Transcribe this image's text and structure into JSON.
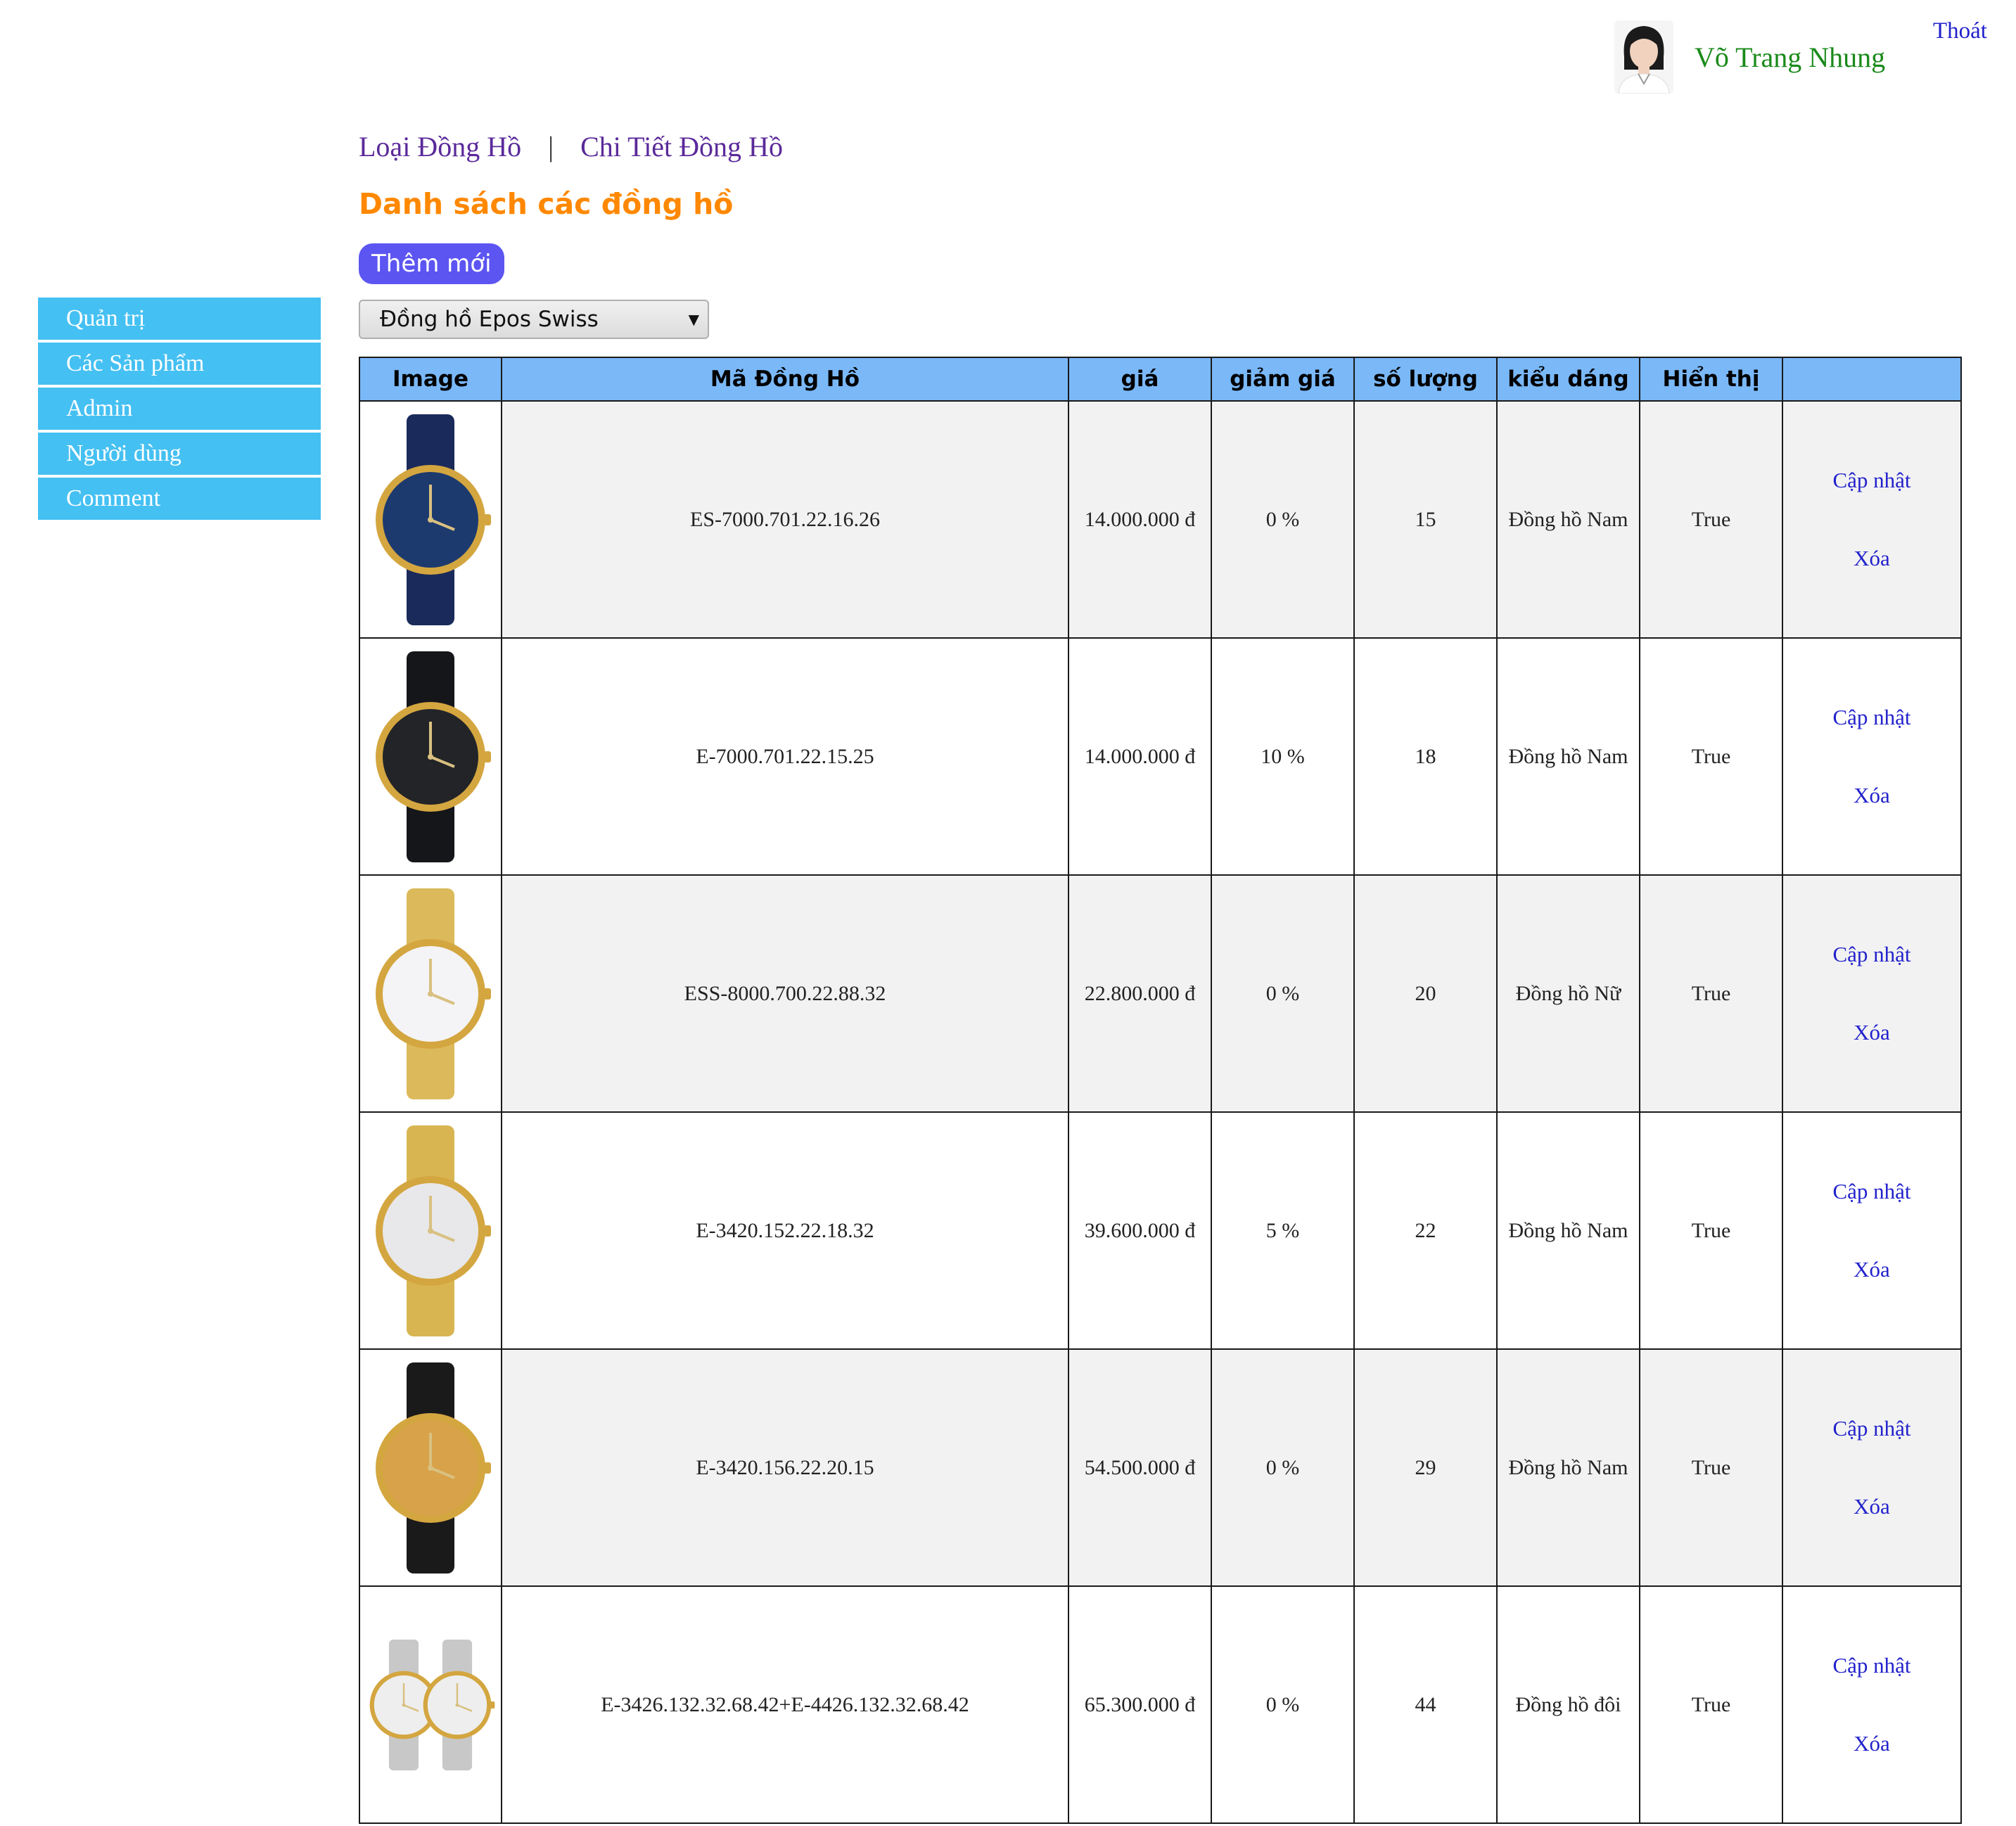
{
  "header": {
    "user_name": "Võ Trang Nhung",
    "logout_label": "Thoát"
  },
  "sidebar": {
    "items": [
      {
        "label": "Quản trị"
      },
      {
        "label": "Các Sản phẩm"
      },
      {
        "label": "Admin"
      },
      {
        "label": "Người dùng"
      },
      {
        "label": "Comment"
      }
    ]
  },
  "nav": {
    "link1": "Loại Đồng Hồ",
    "separator": "|",
    "link2": "Chi Tiết Đồng Hồ"
  },
  "page": {
    "title": "Danh sách các đồng hồ",
    "add_label": "Thêm mới",
    "filter_selected": "Đồng hồ Epos Swiss"
  },
  "table": {
    "headers": [
      "Image",
      "Mã Đồng Hồ",
      "giá",
      "giảm giá",
      "số lượng",
      "kiểu dáng",
      "Hiển thị",
      ""
    ],
    "update_label": "Cập nhật",
    "delete_label": "Xóa",
    "rows": [
      {
        "code": "ES-7000.701.22.16.26",
        "price": "14.000.000 đ",
        "discount": "0 %",
        "qty": "15",
        "style": "Đồng hồ Nam",
        "visible": "True",
        "dial": "#1d3a6e",
        "strap": "#1a2a5a",
        "case": "#d4a640"
      },
      {
        "code": "E-7000.701.22.15.25",
        "price": "14.000.000 đ",
        "discount": "10 %",
        "qty": "18",
        "style": "Đồng hồ Nam",
        "visible": "True",
        "dial": "#222428",
        "strap": "#15161a",
        "case": "#d4a640"
      },
      {
        "code": "ESS-8000.700.22.88.32",
        "price": "22.800.000 đ",
        "discount": "0 %",
        "qty": "20",
        "style": "Đồng hồ Nữ",
        "visible": "True",
        "dial": "#f4f4f6",
        "strap": "#dcb95a",
        "case": "#d4a640"
      },
      {
        "code": "E-3420.152.22.18.32",
        "price": "39.600.000 đ",
        "discount": "5 %",
        "qty": "22",
        "style": "Đồng hồ Nam",
        "visible": "True",
        "dial": "#e8e8ea",
        "strap": "#d9b552",
        "case": "#d4a640"
      },
      {
        "code": "E-3420.156.22.20.15",
        "price": "54.500.000 đ",
        "discount": "0 %",
        "qty": "29",
        "style": "Đồng hồ Nam",
        "visible": "True",
        "dial": "#d8a24a",
        "strap": "#1a1a1a",
        "case": "#d4a640"
      },
      {
        "code": "E-3426.132.32.68.42+E-4426.132.32.68.42",
        "price": "65.300.000 đ",
        "discount": "0 %",
        "qty": "44",
        "style": "Đồng hồ đôi",
        "visible": "True",
        "dial": "#eeeeee",
        "strap": "#c8c8c8",
        "case": "#d4a640"
      }
    ]
  }
}
